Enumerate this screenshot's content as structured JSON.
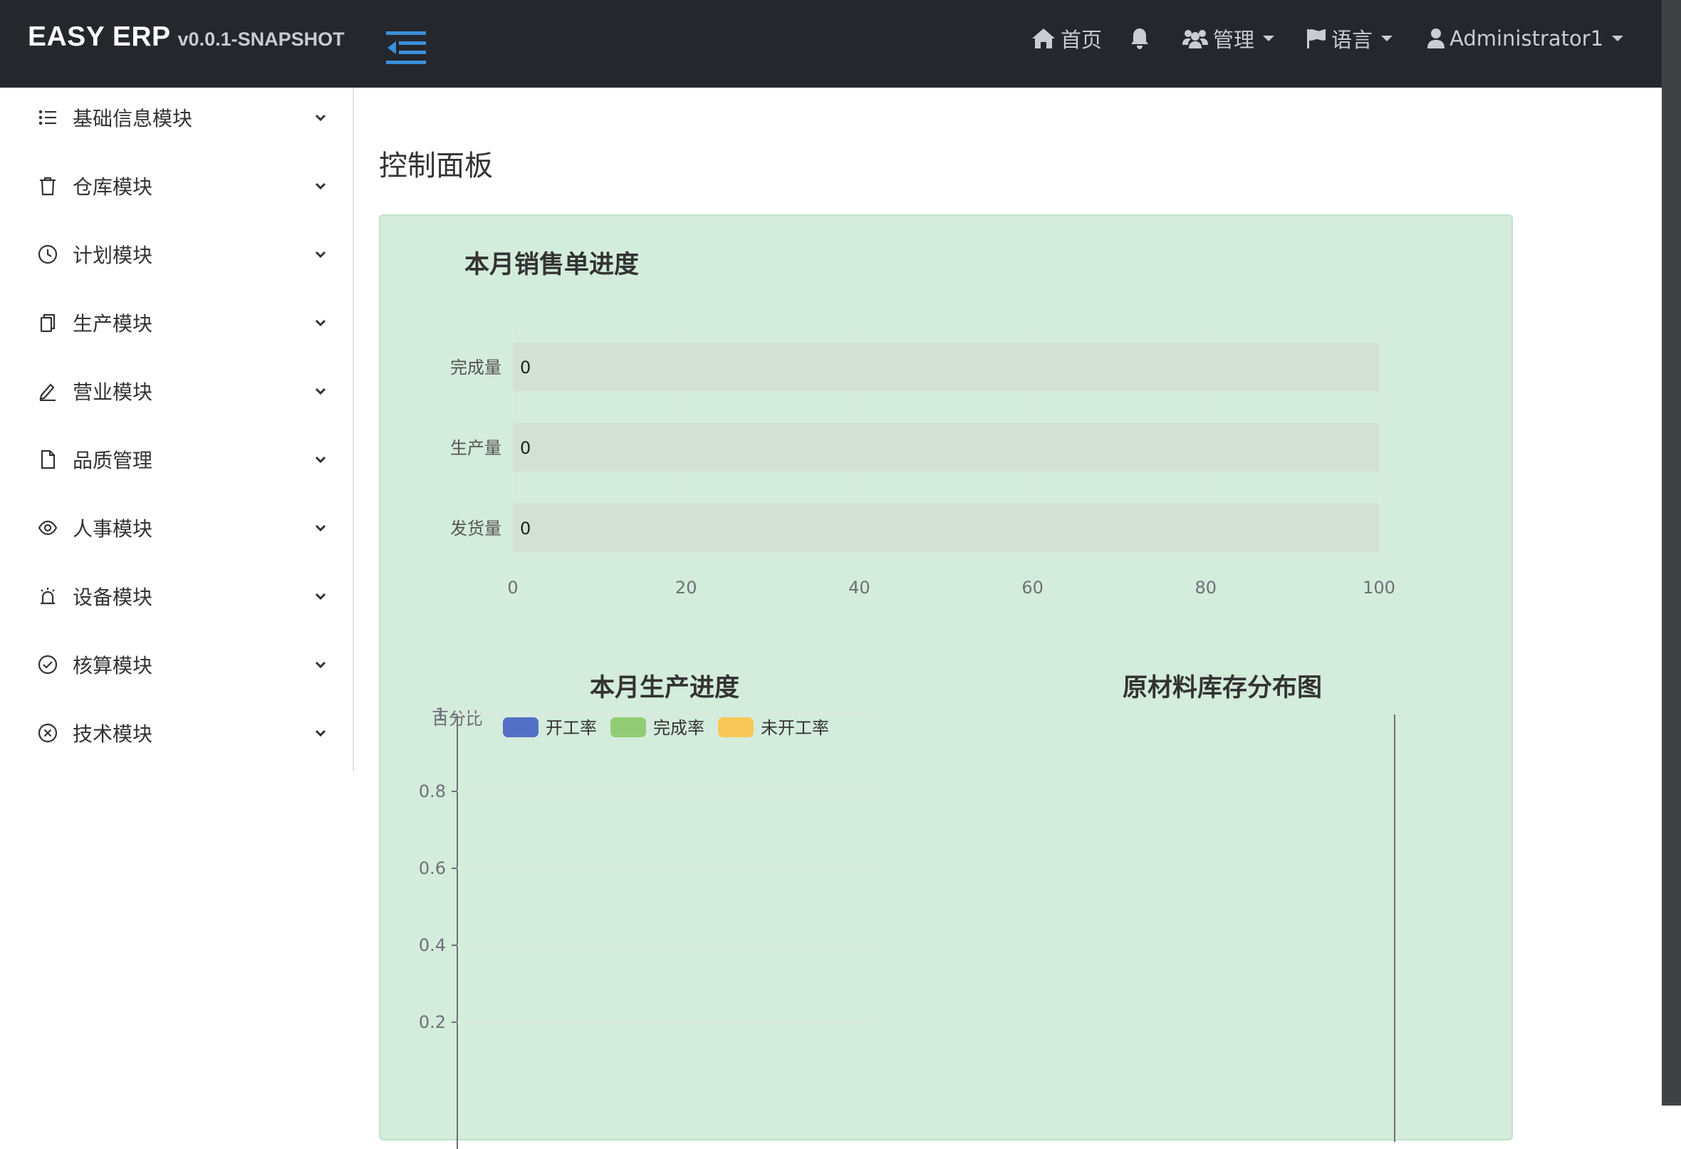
{
  "brand": {
    "name": "EASY ERP",
    "version": "v0.0.1-SNAPSHOT"
  },
  "nav": {
    "home": "首页",
    "manage": "管理",
    "language": "语言",
    "user": "Administrator1"
  },
  "sidebar": {
    "items": [
      {
        "label": "基础信息模块",
        "icon": "list-icon"
      },
      {
        "label": "仓库模块",
        "icon": "trash-icon"
      },
      {
        "label": "计划模块",
        "icon": "clock-icon"
      },
      {
        "label": "生产模块",
        "icon": "copy-icon"
      },
      {
        "label": "营业模块",
        "icon": "pen-icon"
      },
      {
        "label": "品质管理",
        "icon": "file-icon"
      },
      {
        "label": "人事模块",
        "icon": "eye-icon"
      },
      {
        "label": "设备模块",
        "icon": "alarm-icon"
      },
      {
        "label": "核算模块",
        "icon": "check-circle-icon"
      },
      {
        "label": "技术模块",
        "icon": "x-circle-icon"
      }
    ]
  },
  "main": {
    "title": "控制面板"
  },
  "colors": {
    "navbar": "#24272c",
    "card_bg": "#d4ecdb",
    "series_start": "#5470c6",
    "series_complete": "#91cc75",
    "series_unstarted": "#fac858",
    "toggle_accent": "#3b8fd9"
  },
  "chart_data": [
    {
      "type": "bar",
      "title": "本月销售单进度",
      "orientation": "horizontal",
      "categories": [
        "完成量",
        "生产量",
        "发货量"
      ],
      "values": [
        0,
        0,
        0
      ],
      "data_labels": [
        "0",
        "0",
        "0"
      ],
      "xlim": [
        0,
        100
      ],
      "x_ticks": [
        "0",
        "20",
        "40",
        "60",
        "80",
        "100"
      ],
      "grid": true,
      "show_background": true
    },
    {
      "type": "bar",
      "title": "本月生产进度",
      "ylabel": "百分比",
      "series": [
        {
          "name": "开工率",
          "values": []
        },
        {
          "name": "完成率",
          "values": []
        },
        {
          "name": "未开工率",
          "values": []
        }
      ],
      "ylim": [
        0,
        1
      ],
      "y_ticks": [
        "0.2",
        "0.4",
        "0.6",
        "0.8",
        "1"
      ],
      "legend": "top",
      "grid": true
    },
    {
      "type": "bar",
      "title": "原材料库存分布图",
      "series": []
    }
  ]
}
